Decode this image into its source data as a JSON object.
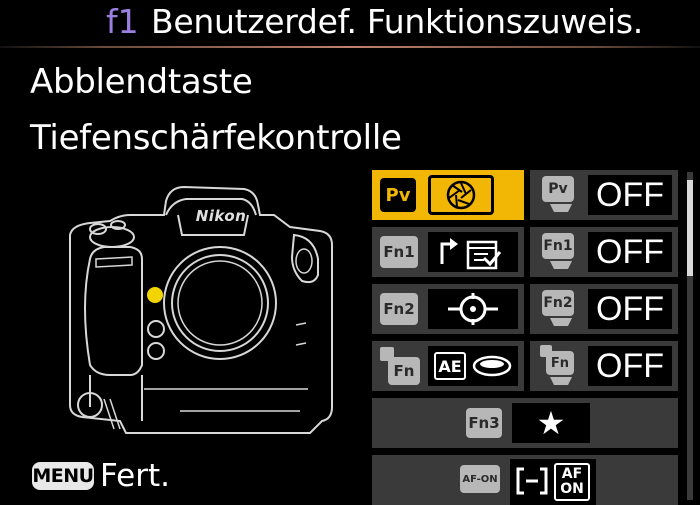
{
  "header": {
    "code": "f1",
    "title": "Benutzerdef. Funktionszuweis."
  },
  "item": {
    "name": "Abblendtaste",
    "description": "Tiefenschärfekontrolle"
  },
  "camera": {
    "brand": "Nikon"
  },
  "grid": {
    "pv_label": "Pv",
    "fn1_label": "Fn1",
    "fn2_label": "Fn2",
    "fn_label": "Fn",
    "fn3_label": "Fn3",
    "afon_label": "AF-ON",
    "ae_label": "AE",
    "af_label_top": "AF",
    "af_label_bottom": "ON",
    "pv_vertical_value": "OFF",
    "fn1_vertical_value": "OFF",
    "fn2_vertical_value": "OFF",
    "fn_vertical_value": "OFF",
    "selected_color": "#f2b705"
  },
  "footer": {
    "menu_label": "MENU",
    "action_label": "Fert."
  }
}
